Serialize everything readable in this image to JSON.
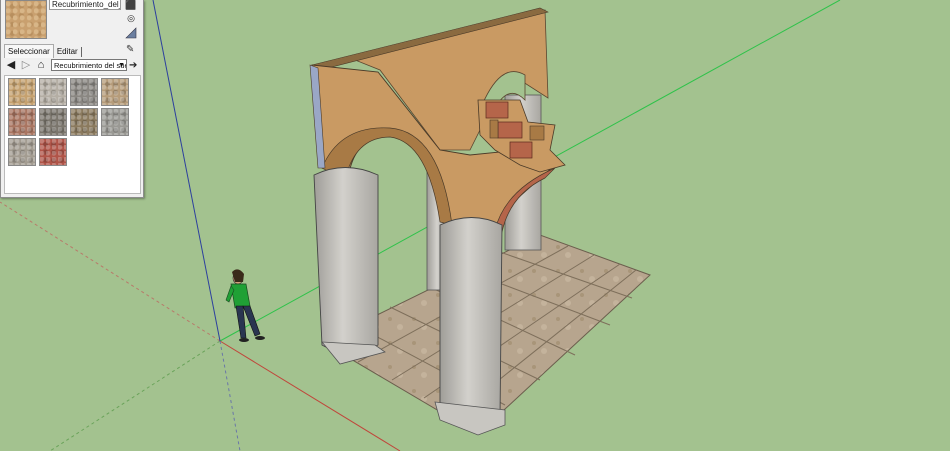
{
  "materials_panel": {
    "material_name": "Recubrimiento_del_suelo",
    "tabs": [
      {
        "label": "Seleccionar",
        "active": true
      },
      {
        "label": "Editar",
        "active": false
      }
    ],
    "collection": "Recubrimiento del suelo",
    "icons": {
      "back": "back-arrow-icon",
      "forward": "forward-arrow-icon",
      "home": "home-icon",
      "details": "details-arrow-icon",
      "eyedropper": "eyedropper-icon",
      "camera": "camera-icon",
      "create": "create-material-icon",
      "sample": "sample-paint-icon"
    },
    "swatches": [
      {
        "color": "#c5a16f"
      },
      {
        "color": "#b4aea4"
      },
      {
        "color": "#8a8782"
      },
      {
        "color": "#b69c7a"
      },
      {
        "color": "#a97561"
      },
      {
        "color": "#7b766d"
      },
      {
        "color": "#8b7a5e"
      },
      {
        "color": "#9a9994"
      },
      {
        "color": "#a39c91"
      },
      {
        "color": "#b05448"
      }
    ]
  },
  "scene": {
    "background": "#a3c28f",
    "colors": {
      "stucco": "#c99a63",
      "stucco_dark": "#a87a45",
      "brick": "#b5654a",
      "column": "#c8c6c1",
      "column_shadow": "#a9a7a2",
      "floor_tile": "#b7a58e",
      "axis_green": "#2fc24a",
      "axis_red": "#c0463b",
      "axis_blue": "#2c3f9e"
    }
  }
}
